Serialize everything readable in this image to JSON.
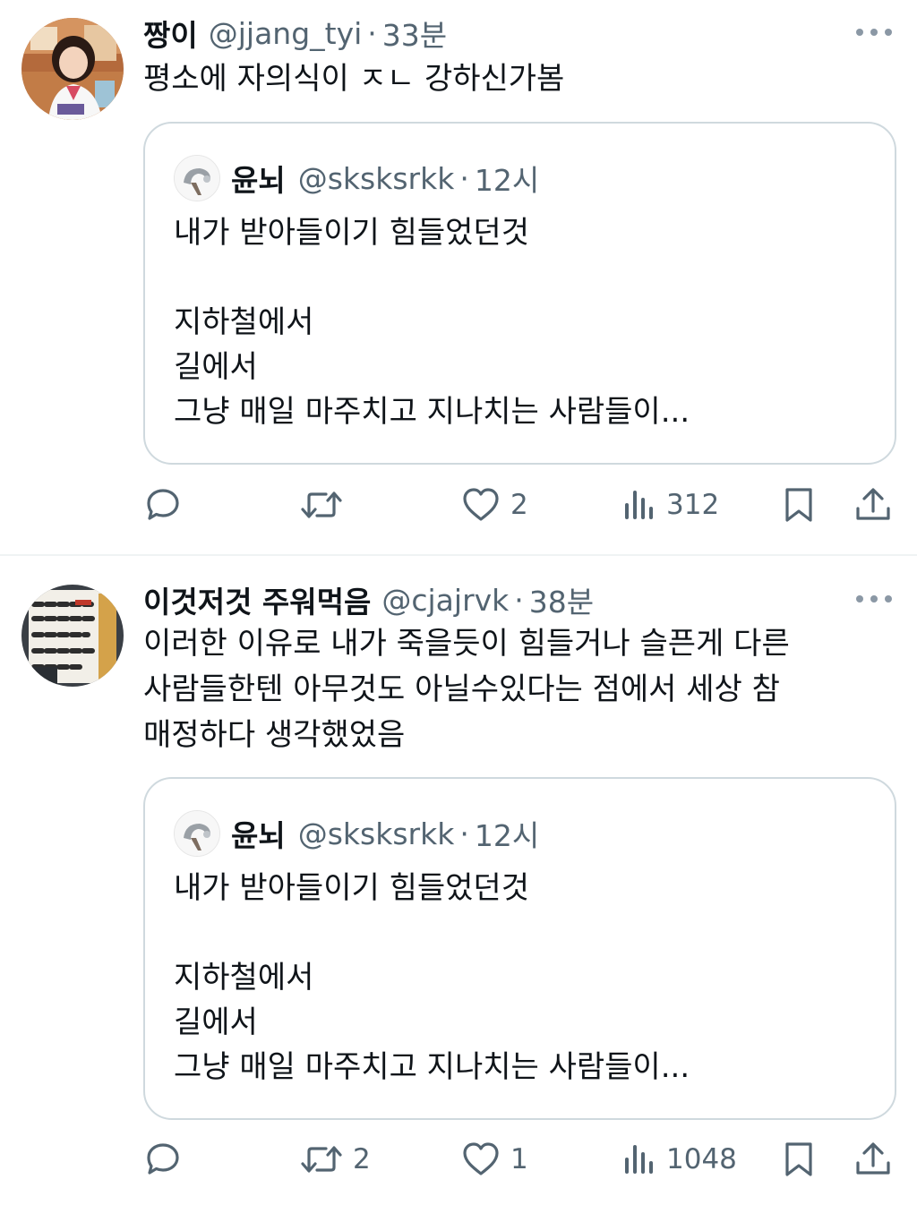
{
  "tweets": [
    {
      "display_name": "짱이",
      "handle": "@jjang_tyi",
      "separator": "·",
      "time": "33분",
      "text": "평소에 자의식이 ㅈㄴ 강하신가봄",
      "avatar_icon": "profile-photo",
      "quote": {
        "display_name": "윤뇌",
        "handle": "@sksksrkk",
        "separator": "·",
        "time": "12시",
        "text": "내가 받아들이기 힘들었던것\n\n지하철에서\n길에서\n그냥 매일 마주치고 지나치는 사람들이..."
      },
      "actions": {
        "replies": "",
        "retweets": "",
        "likes": "2",
        "views": "312"
      }
    },
    {
      "display_name": "이것저것 주워먹음",
      "handle": "@cjajrvk",
      "separator": "·",
      "time": "38분",
      "text": "이러한 이유로 내가 죽을듯이 힘들거나 슬픈게 다른 사람들한텐 아무것도 아닐수있다는 점에서 세상 참 매정하다 생각했었음",
      "avatar_icon": "photo-of-handwritten-sign",
      "quote": {
        "display_name": "윤뇌",
        "handle": "@sksksrkk",
        "separator": "·",
        "time": "12시",
        "text": "내가 받아들이기 힘들었던것\n\n지하철에서\n길에서\n그냥 매일 마주치고 지나치는 사람들이..."
      },
      "actions": {
        "replies": "",
        "retweets": "2",
        "likes": "1",
        "views": "1048"
      }
    }
  ],
  "colors": {
    "text_primary": "#0f1419",
    "text_secondary": "#536471",
    "border": "#cfd9de",
    "divider": "#eff3f4"
  }
}
